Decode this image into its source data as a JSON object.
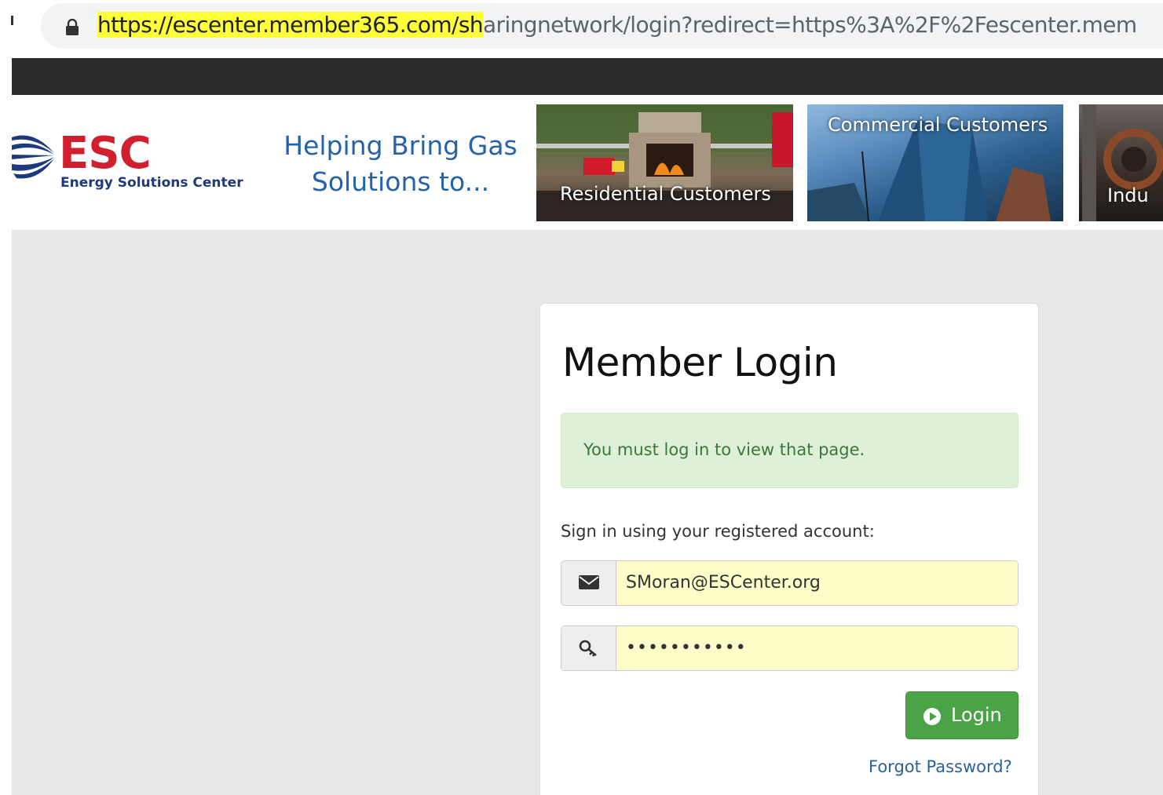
{
  "browser": {
    "url_highlighted": "https://escenter.member365.com/sh",
    "url_rest": "aringnetwork/login?redirect=https%3A%2F%2Fescenter.mem"
  },
  "header": {
    "logo_abbr": "ESC",
    "logo_full": "Energy Solutions Center",
    "tagline_line1": "Helping Bring Gas",
    "tagline_line2": "Solutions to...",
    "tiles": [
      {
        "label": "Residential Customers"
      },
      {
        "label": "Commercial Customers"
      },
      {
        "label": "Indu"
      }
    ]
  },
  "login": {
    "title": "Member Login",
    "alert": "You must log in to view that page.",
    "signin_label": "Sign in using your registered account:",
    "email_value": "SMoran@ESCenter.org",
    "password_mask": "•••••••••••",
    "login_button": "Login",
    "forgot_link": "Forgot Password?"
  },
  "colors": {
    "url_highlight": "#ffff3a",
    "logo_red": "#d0202e",
    "logo_blue": "#1d3b7c",
    "tagline_blue": "#2662a8",
    "alert_bg": "#dff0d8",
    "alert_text": "#3c763d",
    "autofill_bg": "#fdfdc9",
    "button_green": "#4aa447",
    "link_blue": "#2a6496"
  },
  "icons": {
    "lock": "lock-icon",
    "email": "envelope-icon",
    "password": "key-icon",
    "login": "play-circle-icon"
  }
}
